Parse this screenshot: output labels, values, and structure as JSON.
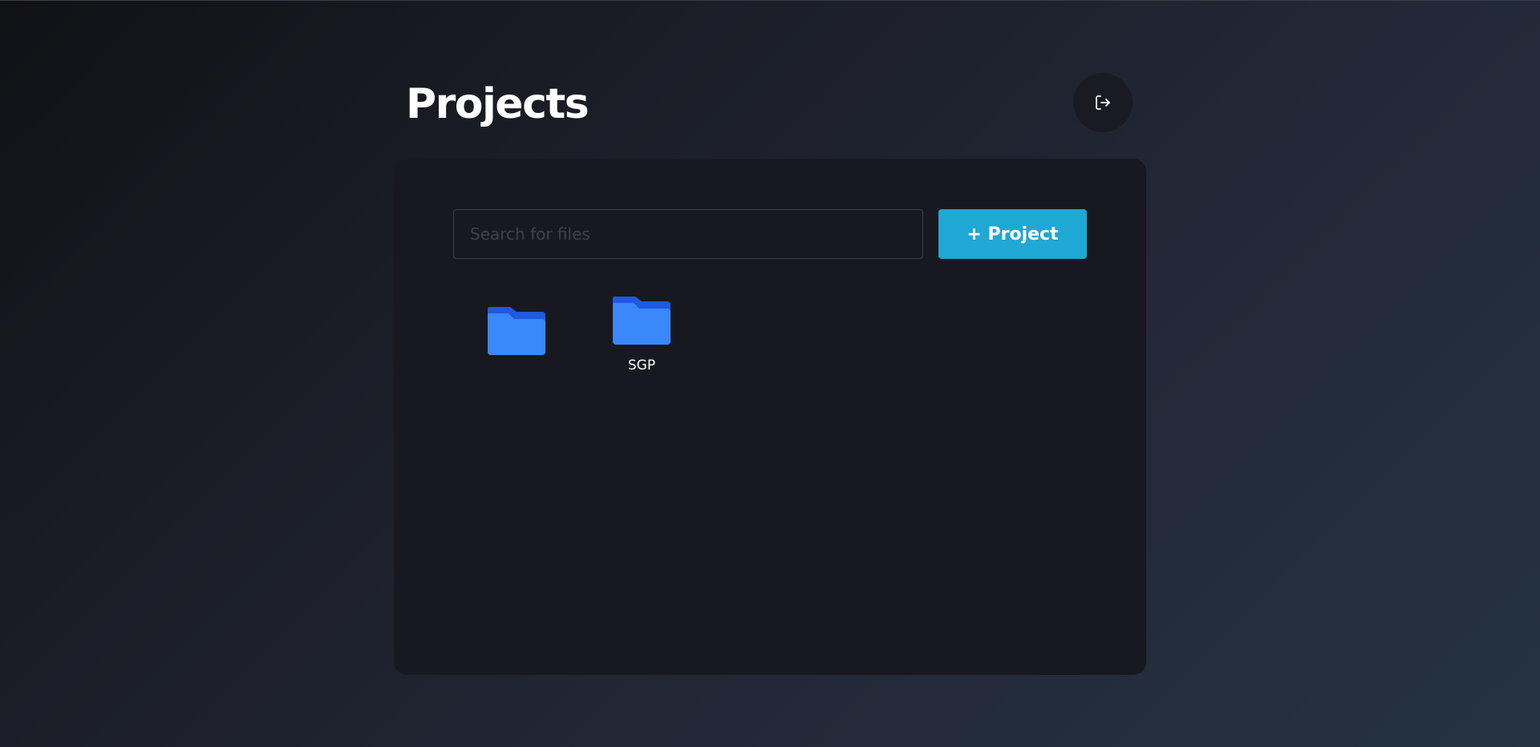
{
  "header": {
    "title": "Projects",
    "logout_icon": "logout-icon"
  },
  "toolbar": {
    "search_placeholder": "Search for files",
    "search_value": "",
    "add_project_label": "+ Project"
  },
  "folders": [
    {
      "name": "",
      "icon": "folder-icon"
    },
    {
      "name": "SGP",
      "icon": "folder-icon"
    }
  ],
  "colors": {
    "accent": "#1fa8d3",
    "panel": "#181920",
    "folder": "#3b88fb",
    "folder_back": "#1f5ae0"
  }
}
